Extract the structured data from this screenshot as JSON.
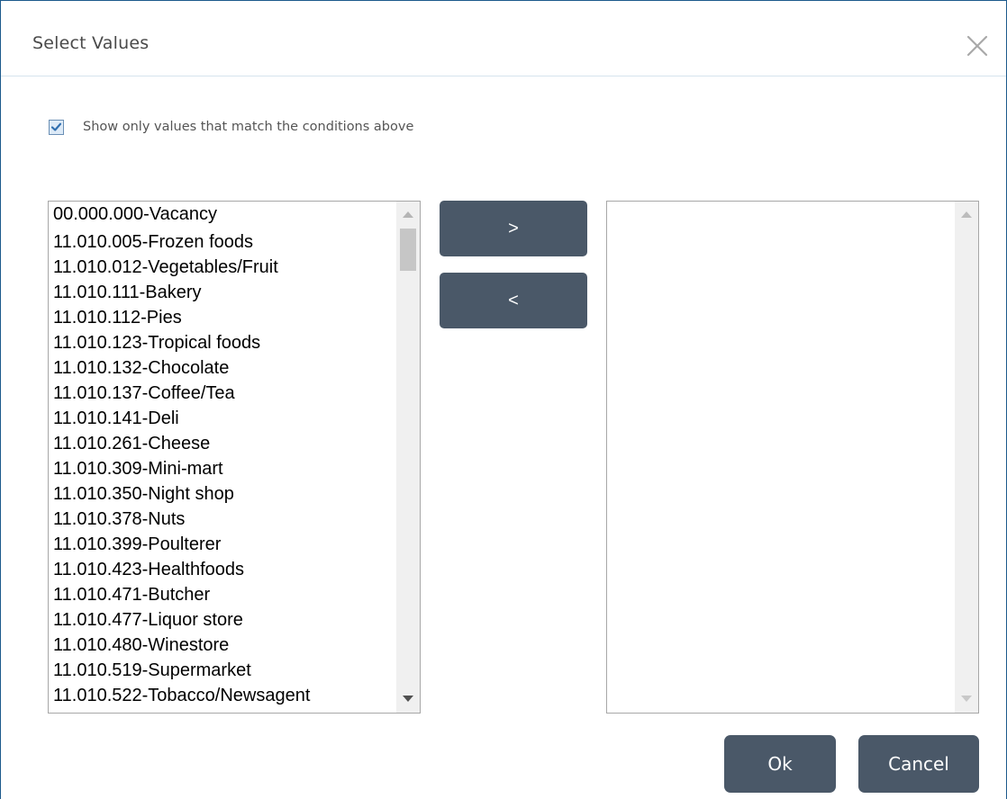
{
  "dialog": {
    "title": "Select Values",
    "close_icon": "close-icon"
  },
  "filter": {
    "checked": true,
    "label": "Show only values that match the conditions above"
  },
  "available_list": {
    "items": [
      "00.000.000-Vacancy",
      "11.010.005-Frozen foods",
      "11.010.012-Vegetables/Fruit",
      "11.010.111-Bakery",
      "11.010.112-Pies",
      "11.010.123-Tropical foods",
      "11.010.132-Chocolate",
      "11.010.137-Coffee/Tea",
      "11.010.141-Deli",
      "11.010.261-Cheese",
      "11.010.309-Mini-mart",
      "11.010.350-Night shop",
      "11.010.378-Nuts",
      "11.010.399-Poulterer",
      "11.010.423-Healthfoods",
      "11.010.471-Butcher",
      "11.010.477-Liquor store",
      "11.010.480-Winestore",
      "11.010.519-Supermarket",
      "11.010.522-Tobacco/Newsagent"
    ]
  },
  "selected_list": {
    "items": []
  },
  "move_buttons": {
    "add_label": ">",
    "remove_label": "<"
  },
  "actions": {
    "ok_label": "Ok",
    "cancel_label": "Cancel"
  },
  "colors": {
    "button_bg": "#4a5868",
    "dialog_border": "#1c5a8c",
    "checkbox_check": "#2f6fb0"
  }
}
